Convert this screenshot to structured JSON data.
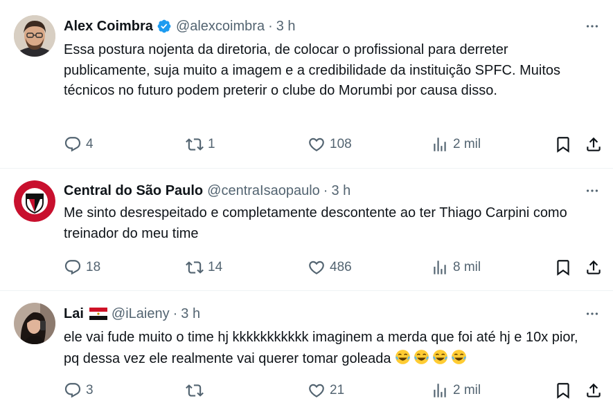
{
  "tweets": [
    {
      "name": "Alex Coimbra",
      "handle": "@alexcoimbra",
      "separator": "·",
      "time": "3 h",
      "verified": true,
      "text": "Essa postura nojenta da diretoria, de colocar o profissional para derreter publicamente, suja muito a imagem e a credibilidade da instituição SPFC. Muitos técnicos no futuro podem preterir o clube do Morumbi por causa disso.",
      "replies": "4",
      "retweets": "1",
      "likes": "108",
      "views": "2 mil"
    },
    {
      "name": "Central do São Paulo",
      "handle": "@centraIsaopaulo",
      "separator": "·",
      "time": "3 h",
      "verified": false,
      "text": "Me sinto desrespeitado e completamente descontente ao ter Thiago Carpini como treinador do meu time",
      "replies": "18",
      "retweets": "14",
      "likes": "486",
      "views": "8 mil"
    },
    {
      "name": "Lai",
      "name_flag": "flag-egypt-icon",
      "handle": "@iLaieny",
      "separator": "·",
      "time": "3 h",
      "verified": false,
      "text": "ele vai fude muito o time hj kkkkkkkkkkk imaginem a merda que foi até hj e 10x pior, pq dessa vez ele realmente vai querer tomar goleada",
      "text_emojis": [
        "face-with-tears-of-joy-icon",
        "face-with-tears-of-joy-icon",
        "face-with-tears-of-joy-icon",
        "face-with-tears-of-joy-icon"
      ],
      "replies": "3",
      "retweets": "",
      "likes": "21",
      "views": "2 mil"
    }
  ],
  "colors": {
    "text": "#0f1419",
    "secondary": "#536471",
    "verified": "#1d9bf0",
    "divider": "#eff3f4",
    "spfc_red": "#c8102e"
  },
  "icons": [
    "more-icon",
    "reply-icon",
    "retweet-icon",
    "like-icon",
    "views-icon",
    "bookmark-icon",
    "share-icon",
    "verified-badge-icon"
  ]
}
